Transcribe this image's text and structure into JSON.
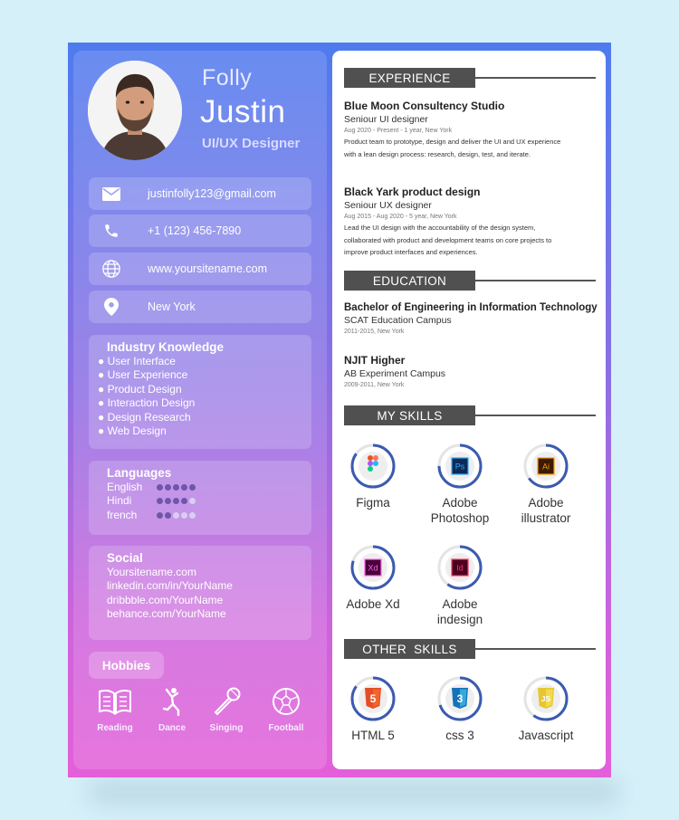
{
  "profile": {
    "first_name": "Folly",
    "last_name": "Justin",
    "role": "UI/UX Designer"
  },
  "contacts": [
    {
      "icon": "mail-icon",
      "text": "justinfolly123@gmail.com"
    },
    {
      "icon": "phone-icon",
      "text": "+1 (123) 456-7890"
    },
    {
      "icon": "globe-icon",
      "text": "www.yoursitename.com"
    },
    {
      "icon": "location-pin-icon",
      "text": "New York"
    }
  ],
  "industry": {
    "title": "Industry Knowledge",
    "items": [
      "User Interface",
      "User Experience",
      "Product Design",
      "Interaction Design",
      "Design Research",
      "Web Design"
    ]
  },
  "languages": {
    "title": "Languages",
    "items": [
      {
        "name": "English",
        "level": 5
      },
      {
        "name": "Hindi",
        "level": 4
      },
      {
        "name": "french",
        "level": 2
      }
    ],
    "max_level": 5
  },
  "social": {
    "title": "Social",
    "items": [
      "Yoursitename.com",
      "linkedin.com/in/YourName",
      "dribbble.com/YourName",
      "behance.com/YourName"
    ]
  },
  "hobbies": {
    "title": "Hobbies",
    "items": [
      {
        "icon": "book-icon",
        "label": "Reading"
      },
      {
        "icon": "dance-icon",
        "label": "Dance"
      },
      {
        "icon": "microphone-icon",
        "label": "Singing"
      },
      {
        "icon": "football-icon",
        "label": "Football"
      }
    ]
  },
  "experience": {
    "title": "EXPERIENCE",
    "jobs": [
      {
        "company": "Blue Moon Consultency Studio",
        "position": "Seniour UI designer",
        "dates": "Aug 2020 - Present - 1 year, New York",
        "desc": "Product team to prototype, design and deliver the UI and UX experience with a lean design process: research, design, test, and iterate."
      },
      {
        "company": "Black Yark product design",
        "position": "Seniour UX designer",
        "dates": "Aug 2015 - Aug 2020 - 5 year, New York",
        "desc": "Lead the UI design with the accountability of the design system, collaborated with product and development teams on core projects to improve product interfaces and experiences."
      }
    ]
  },
  "education": {
    "title": "EDUCATION",
    "items": [
      {
        "degree": "Bachelor of Engineering in Information Technology",
        "school": "SCAT Education Campus",
        "dates": "2011-2015, New York"
      },
      {
        "degree": "NJIT Higher",
        "school": "AB Experiment Campus",
        "dates": "2009-2011, New York"
      }
    ]
  },
  "skills": {
    "title": "MY SKILLS",
    "items": [
      {
        "name": "Figma",
        "level": 0.85,
        "icon": "figma-icon",
        "badge": "",
        "color": "#ffffff"
      },
      {
        "name": "Adobe Photoshop",
        "level": 0.75,
        "icon": "photoshop-icon",
        "badge": "Ps",
        "color": "#0b2a55"
      },
      {
        "name": "Adobe illustrator",
        "level": 0.65,
        "icon": "illustrator-icon",
        "badge": "Ai",
        "color": "#3a1a00"
      },
      {
        "name": "Adobe Xd",
        "level": 0.8,
        "icon": "xd-icon",
        "badge": "Xd",
        "color": "#470137"
      },
      {
        "name": "Adobe indesign",
        "level": 0.6,
        "icon": "indesign-icon",
        "badge": "Id",
        "color": "#49021f"
      }
    ]
  },
  "other_skills": {
    "title": "OTHER  SKILLS",
    "items": [
      {
        "name": "HTML 5",
        "level": 0.85,
        "icon": "html5-icon",
        "badge": "5",
        "color": "#e44d26"
      },
      {
        "name": "css 3",
        "level": 0.7,
        "icon": "css3-icon",
        "badge": "3",
        "color": "#2965f1"
      },
      {
        "name": "Javascript",
        "level": 0.6,
        "icon": "javascript-icon",
        "badge": "JS",
        "color": "#f0db4f"
      }
    ]
  },
  "colors": {
    "ring": "#3b5bb0",
    "ring_track": "#e4e4e4",
    "section_pill": "#505050"
  }
}
